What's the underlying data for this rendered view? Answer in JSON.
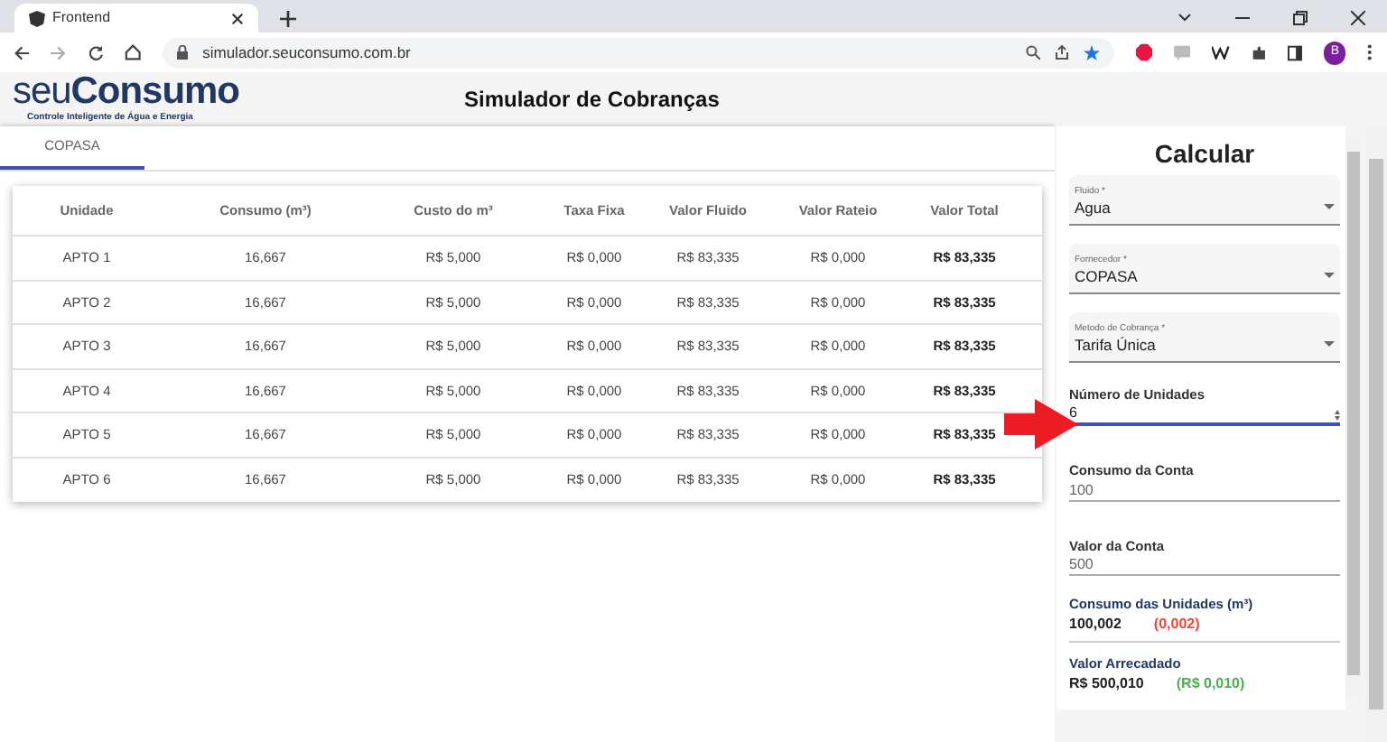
{
  "browser": {
    "tab_title": "Frontend",
    "url": "simulador.seuconsumo.com.br",
    "profile_initial": "B"
  },
  "header": {
    "logo_light": "seu",
    "logo_bold": "Consumo",
    "tagline": "Controle Inteligente de Água e Energia",
    "title": "Simulador de Cobranças"
  },
  "tabs": [
    {
      "label": "COPASA",
      "selected": true
    }
  ],
  "table": {
    "columns": [
      "Unidade",
      "Consumo (m³)",
      "Custo do m³",
      "Taxa Fixa",
      "Valor Fluido",
      "Valor Rateio",
      "Valor Total"
    ],
    "rows": [
      [
        "APTO 1",
        "16,667",
        "R$ 5,000",
        "R$ 0,000",
        "R$ 83,335",
        "R$ 0,000",
        "R$ 83,335"
      ],
      [
        "APTO 2",
        "16,667",
        "R$ 5,000",
        "R$ 0,000",
        "R$ 83,335",
        "R$ 0,000",
        "R$ 83,335"
      ],
      [
        "APTO 3",
        "16,667",
        "R$ 5,000",
        "R$ 0,000",
        "R$ 83,335",
        "R$ 0,000",
        "R$ 83,335"
      ],
      [
        "APTO 4",
        "16,667",
        "R$ 5,000",
        "R$ 0,000",
        "R$ 83,335",
        "R$ 0,000",
        "R$ 83,335"
      ],
      [
        "APTO 5",
        "16,667",
        "R$ 5,000",
        "R$ 0,000",
        "R$ 83,335",
        "R$ 0,000",
        "R$ 83,335"
      ],
      [
        "APTO 6",
        "16,667",
        "R$ 5,000",
        "R$ 0,000",
        "R$ 83,335",
        "R$ 0,000",
        "R$ 83,335"
      ]
    ]
  },
  "panel": {
    "title": "Calcular",
    "selects": [
      {
        "label": "Fluido *",
        "value": "Agua"
      },
      {
        "label": "Fornecedor *",
        "value": "COPASA"
      },
      {
        "label": "Metodo de Cobrança *",
        "value": "Tarifa Única"
      }
    ],
    "fields": [
      {
        "label": "Número de Unidades",
        "value": "6",
        "kind": "number",
        "focused": true
      },
      {
        "label": "Consumo da Conta",
        "value": "100",
        "kind": "text",
        "focused": false
      },
      {
        "label": "Valor da Conta",
        "value": "500",
        "kind": "text",
        "focused": false
      }
    ],
    "results": [
      {
        "label": "Consumo das Unidades (m³)",
        "value": "100,002",
        "difference": "(0,002)",
        "color": "#f44336"
      },
      {
        "label": "Valor Arrecadado",
        "value": "R$ 500,010",
        "difference": "(R$ 0,010)",
        "color": "#4caf50"
      }
    ]
  }
}
